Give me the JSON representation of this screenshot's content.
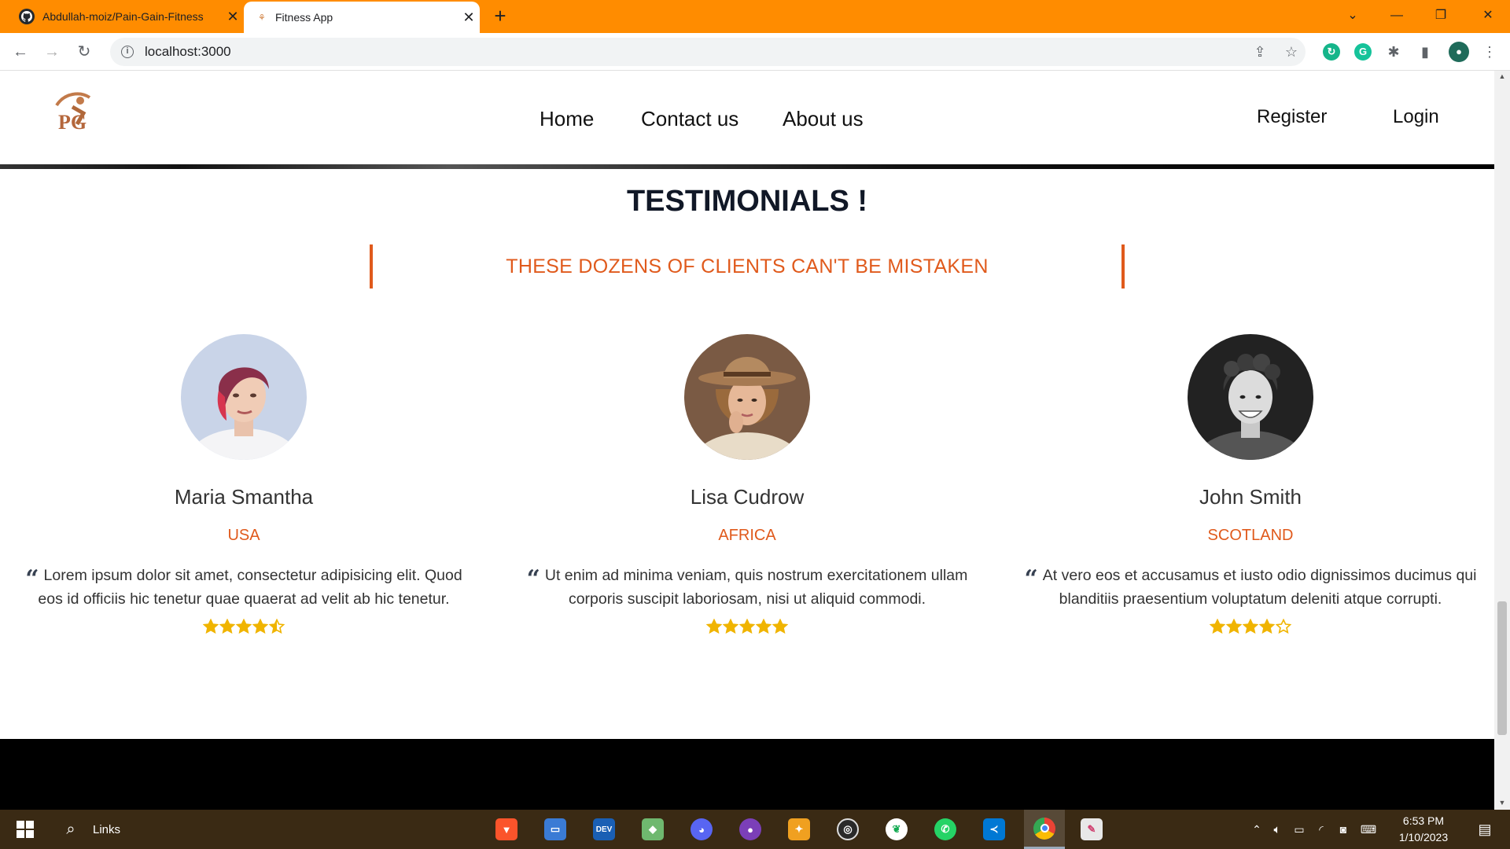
{
  "browser": {
    "tabs": [
      {
        "title": "Abdullah-moiz/Pain-Gain-Fitness",
        "icon": "github-icon",
        "active": false
      },
      {
        "title": "Fitness App",
        "icon": "app-favicon-icon",
        "active": true
      }
    ],
    "url": "localhost:3000"
  },
  "nav": {
    "logo_text": "PG",
    "links": [
      "Home",
      "Contact us",
      "About us"
    ],
    "register": "Register",
    "login": "Login"
  },
  "testimonials": {
    "heading": "TESTIMONIALS !",
    "subtitle": "THESE DOZENS OF CLIENTS CAN'T BE MISTAKEN",
    "items": [
      {
        "name": "Maria Smantha",
        "country": "USA",
        "quote": "Lorem ipsum dolor sit amet, consectetur adipisicing elit. Quod eos id officiis hic tenetur quae quaerat ad velit ab hic tenetur.",
        "rating": 4.5
      },
      {
        "name": "Lisa Cudrow",
        "country": "AFRICA",
        "quote": "Ut enim ad minima veniam, quis nostrum exercitationem ullam corporis suscipit laboriosam, nisi ut aliquid commodi.",
        "rating": 5
      },
      {
        "name": "John Smith",
        "country": "SCOTLAND",
        "quote": "At vero eos et accusamus et iusto odio dignissimos ducimus qui blanditiis praesentium voluptatum deleniti atque corrupti.",
        "rating": 4
      }
    ]
  },
  "colors": {
    "accent": "#e05a1c",
    "star": "#f0b400",
    "tabbar": "#ff8c00"
  },
  "taskbar": {
    "search_label": "Links",
    "apps": [
      "brave-icon",
      "file-explorer-icon",
      "dev-icon",
      "cube-icon",
      "discord-icon",
      "github-desktop-icon",
      "git-kraken-icon",
      "obs-icon",
      "mongodb-icon",
      "whatsapp-icon",
      "vscode-icon",
      "chrome-icon",
      "paint-icon"
    ],
    "time": "6:53 PM",
    "date": "1/10/2023"
  }
}
